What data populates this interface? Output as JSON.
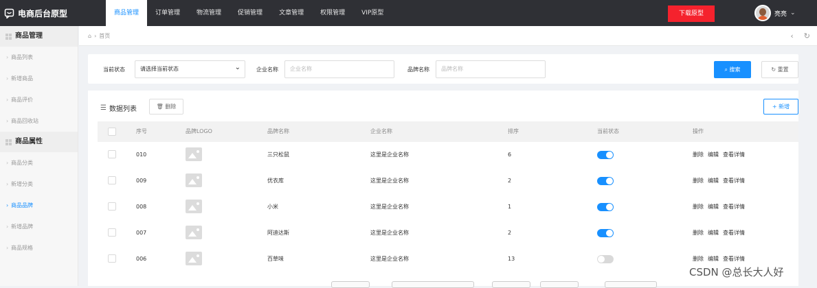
{
  "app": {
    "title": "电商后台原型"
  },
  "nav": {
    "items": [
      "商品管理",
      "订单管理",
      "物流管理",
      "促销管理",
      "文章管理",
      "权限管理",
      "VIP原型"
    ],
    "active_index": 0
  },
  "header": {
    "download_label": "下载原型",
    "user_name": "亮亮"
  },
  "sidebar": {
    "groups": [
      {
        "title": "商品管理",
        "items": [
          "商品列表",
          "新增商品",
          "商品评价",
          "商品回收站"
        ]
      },
      {
        "title": "商品属性",
        "items": [
          "商品分类",
          "新增分类",
          "商品品牌",
          "新增品牌",
          "商品规格"
        ]
      }
    ],
    "active_item": "商品品牌"
  },
  "breadcrumb": {
    "home_icon": "home-icon",
    "current": "首页"
  },
  "filter": {
    "status_label": "当前状态",
    "status_value": "请选择当前状态",
    "company_label": "企业名称",
    "company_placeholder": "企业名称",
    "brand_label": "品牌名称",
    "brand_placeholder": "品牌名称",
    "search_label": "搜索",
    "reset_label": "重置"
  },
  "list": {
    "title": "数据列表",
    "delete_label": "删除",
    "new_label": "新增",
    "columns": [
      "序号",
      "品牌LOGO",
      "品牌名称",
      "企业名称",
      "排序",
      "当前状态",
      "操作"
    ],
    "rows": [
      {
        "id": "010",
        "brand": "三只松鼠",
        "company": "这里是企业名称",
        "sort": "6",
        "enabled": true
      },
      {
        "id": "009",
        "brand": "优衣库",
        "company": "这里是企业名称",
        "sort": "2",
        "enabled": true
      },
      {
        "id": "008",
        "brand": "小米",
        "company": "这里是企业名称",
        "sort": "1",
        "enabled": true
      },
      {
        "id": "007",
        "brand": "阿迪达斯",
        "company": "这里是企业名称",
        "sort": "2",
        "enabled": true
      },
      {
        "id": "006",
        "brand": "百草味",
        "company": "这里是企业名称",
        "sort": "13",
        "enabled": false
      }
    ],
    "actions": [
      "删除",
      "编辑",
      "查看详情"
    ]
  },
  "watermark": "CSDN @总长大人好",
  "colors": {
    "primary": "#1890ff",
    "danger": "#f5222d",
    "topbar": "#2f3035"
  }
}
